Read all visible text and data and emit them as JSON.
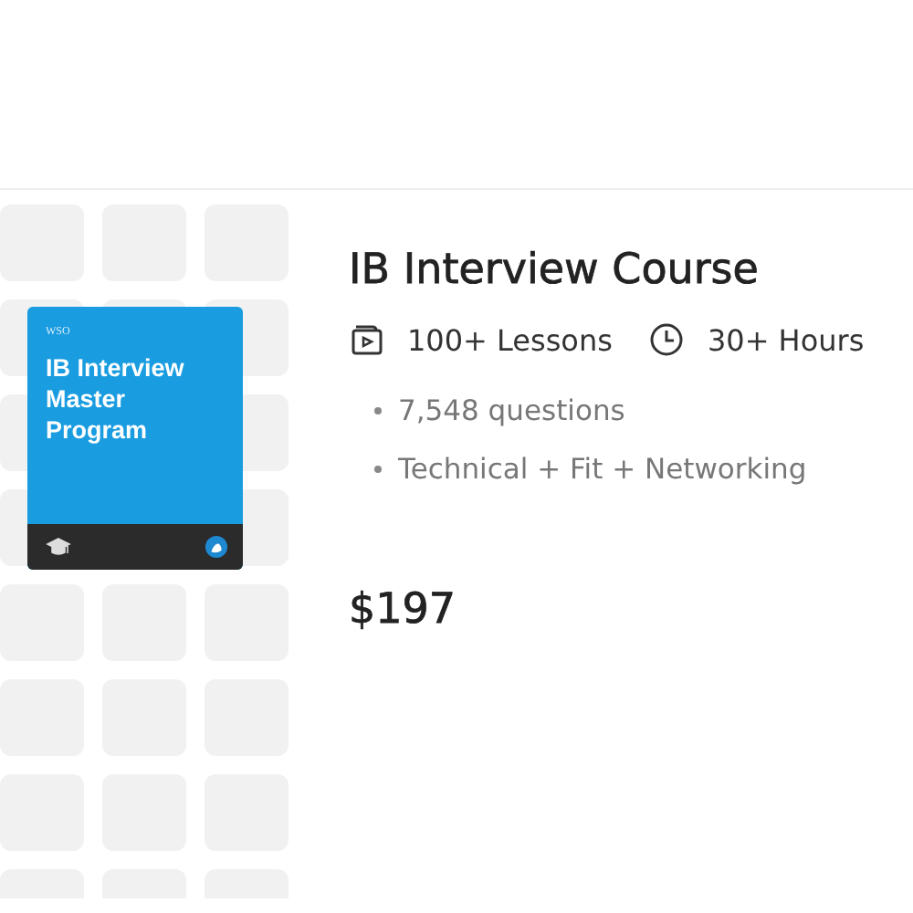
{
  "cover": {
    "brand": "WSO",
    "title": "IB Interview Master Program"
  },
  "course": {
    "title": "IB Interview Course",
    "stats": [
      {
        "kind": "lessons",
        "label": "100+ Lessons"
      },
      {
        "kind": "hours",
        "label": "30+ Hours"
      }
    ],
    "features": [
      "7,548 questions",
      "Technical + Fit + Networking"
    ],
    "price": "$197"
  }
}
